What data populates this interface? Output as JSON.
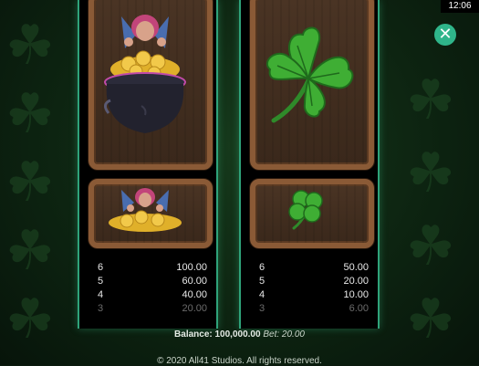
{
  "status_bar": {
    "time": "12:06"
  },
  "close_button": {
    "icon": "close-icon",
    "color": "#2fb58a"
  },
  "symbols": [
    {
      "name": "Fairy Pot of Gold",
      "icon": "fairy-pot-of-gold-icon",
      "paytable": [
        {
          "count": "6",
          "amount": "100.00"
        },
        {
          "count": "5",
          "amount": "60.00"
        },
        {
          "count": "4",
          "amount": "40.00"
        },
        {
          "count": "3",
          "amount": "20.00"
        }
      ]
    },
    {
      "name": "Four Leaf Clover",
      "icon": "four-leaf-clover-icon",
      "paytable": [
        {
          "count": "6",
          "amount": "50.00"
        },
        {
          "count": "5",
          "amount": "20.00"
        },
        {
          "count": "4",
          "amount": "10.00"
        },
        {
          "count": "3",
          "amount": "6.00"
        }
      ]
    }
  ],
  "footer": {
    "balance_label": "Balance:",
    "balance_value": "100,000.00",
    "bet_label": "Bet:",
    "bet_value": "20.00",
    "copyright": "© 2020 All41 Studios. All rights reserved."
  },
  "colors": {
    "accent": "#2fa37a",
    "frame_wood": "#8a5a36",
    "background": "#0d2411"
  }
}
